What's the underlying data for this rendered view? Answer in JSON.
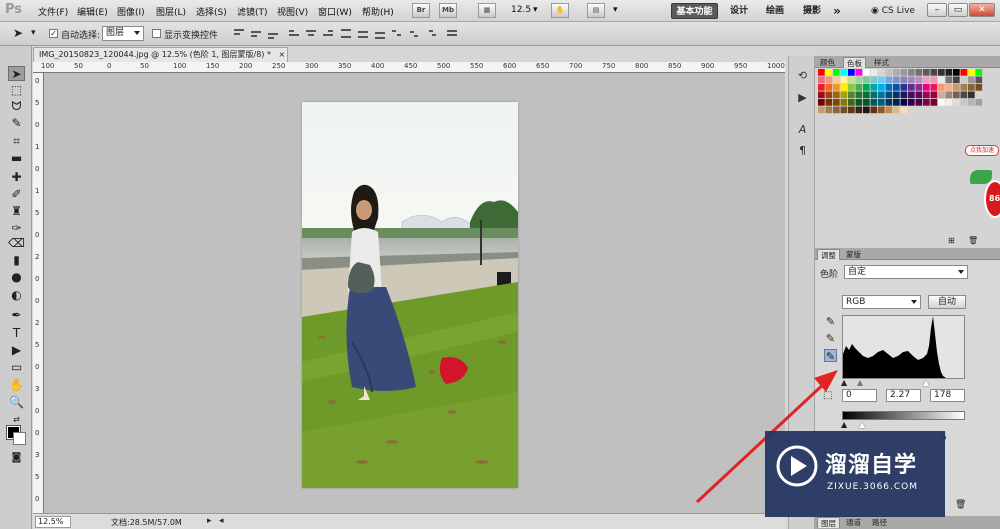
{
  "app": {
    "logo": "Ps",
    "menus": [
      "文件(F)",
      "编辑(E)",
      "图像(I)",
      "图层(L)",
      "选择(S)",
      "滤镜(T)",
      "视图(V)",
      "窗口(W)",
      "帮助(H)"
    ],
    "bridge_icon": "Br",
    "minibridge_icon": "Mb",
    "zoom_level": "12.5",
    "workspaces": [
      "基本功能",
      "设计",
      "绘画",
      "摄影"
    ],
    "more_workspaces": "»",
    "cs_live": "CS Live"
  },
  "options_bar": {
    "auto_select_label": "自动选择:",
    "auto_select_checked": true,
    "auto_select_value": "图层",
    "show_transform_label": "显示变换控件",
    "show_transform_checked": false
  },
  "document": {
    "tab_title": "IMG_20150823_120044.jpg @ 12.5% (色阶 1, 图层蒙版/8) *",
    "close_label": "×",
    "ruler_top_labels": [
      "100",
      "50",
      "0",
      "50",
      "100",
      "150",
      "200",
      "250",
      "300",
      "350",
      "400",
      "450",
      "500",
      "550",
      "600",
      "650",
      "700",
      "750",
      "800",
      "850",
      "900",
      "950",
      "1000"
    ],
    "ruler_left_labels": [
      "0",
      "5",
      "0",
      "1",
      "0",
      "1",
      "5",
      "0",
      "2",
      "0",
      "0",
      "2",
      "5",
      "0",
      "3",
      "0",
      "0",
      "3",
      "5",
      "0"
    ],
    "status_zoom": "12.5%",
    "status_info": "文档:28.5M/57.0M"
  },
  "panels": {
    "swatch_tabs": [
      "颜色",
      "色板",
      "样式"
    ],
    "selected_swatch_tab": "色板",
    "adjust_tabs": [
      "调整",
      "蒙版"
    ],
    "selected_adjust_tab": "调整",
    "bottom_tabs": [
      "图层",
      "通道",
      "路径"
    ],
    "levels": {
      "preset_label": "色阶",
      "preset_value": "自定",
      "channel_value": "RGB",
      "auto_button": "自动",
      "input_black": "0",
      "input_gamma": "2.27",
      "input_white": "178",
      "output_white": "5"
    }
  },
  "colors": {
    "accent": "#d71920",
    "watermark_bg": "#263660",
    "canvas_bg": "#c0c0c0"
  },
  "icons": {
    "move_tool": "move-icon",
    "eyedropper": "eyedropper-icon",
    "arrow_annotation": "red-arrow"
  },
  "watermark": {
    "brand": "溜溜自学",
    "url": "ZIXUE.3066.COM"
  },
  "badge": {
    "bubble_text": "点我加速",
    "number": "86"
  }
}
